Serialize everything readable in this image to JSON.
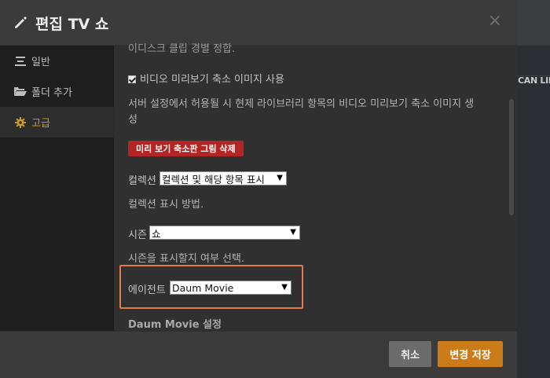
{
  "background": {
    "partial_text": "CAN LIB"
  },
  "modal": {
    "title": "편집 TV 쇼",
    "close_glyph": "×"
  },
  "sidebar": {
    "items": [
      {
        "label": "일반",
        "icon": "list-icon",
        "active": false
      },
      {
        "label": "폴더 추가",
        "icon": "folder-icon",
        "active": false
      },
      {
        "label": "고급",
        "icon": "gear-icon",
        "active": true
      }
    ]
  },
  "content": {
    "cut_text": "이디스크 클립 경별 정합.",
    "video_preview_checkbox": {
      "label": "비디오 미리보기 축소 이미지 사용",
      "checked": true
    },
    "video_preview_help": [
      "서버 설정에서 허용될 시 현제 라이브러리 항목의 비디오 미리보기 축소 이미지 생",
      "성"
    ],
    "delete_thumbnails_button": "미리 보기 축소판 그림 삭제",
    "collection": {
      "label": "컬렉션",
      "value": "컬렉션 및 해당 항목 표시",
      "help": "컬렉션 표시 방법."
    },
    "season": {
      "label": "시즌",
      "value": "쇼",
      "help": "시즌을 표시할지 여부 선택."
    },
    "agent": {
      "label": "에이전트",
      "value": "Daum Movie"
    },
    "agent_settings_heading": "Daum Movie 설정"
  },
  "footer": {
    "cancel_label": "취소",
    "save_label": "변경 저장"
  },
  "colors": {
    "accent": "#cc7b19",
    "active_item": "#cc9a28",
    "danger": "#b32525",
    "highlight_border": "#e07b45"
  }
}
